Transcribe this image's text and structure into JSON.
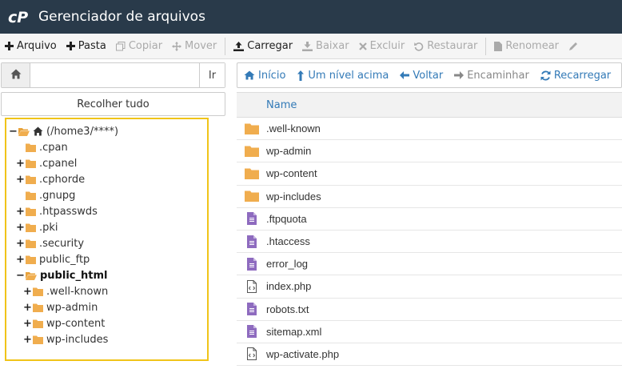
{
  "header": {
    "title": "Gerenciador de arquivos",
    "logo": "cP"
  },
  "toolbar": {
    "buttons": [
      {
        "label": "Arquivo",
        "icon": "plus-icon",
        "enabled": true
      },
      {
        "label": "Pasta",
        "icon": "plus-icon",
        "enabled": true
      },
      {
        "label": "Copiar",
        "icon": "copy-icon",
        "enabled": false
      },
      {
        "label": "Mover",
        "icon": "move-icon",
        "enabled": false
      },
      {
        "label": "Carregar",
        "icon": "upload-icon",
        "enabled": true
      },
      {
        "label": "Baixar",
        "icon": "download-icon",
        "enabled": false
      },
      {
        "label": "Excluir",
        "icon": "delete-icon",
        "enabled": false
      },
      {
        "label": "Restaurar",
        "icon": "restore-icon",
        "enabled": false
      },
      {
        "label": "Renomear",
        "icon": "rename-icon",
        "enabled": false
      }
    ]
  },
  "path": {
    "value": "",
    "go_label": "Ir"
  },
  "collapse_label": "Recolher tudo",
  "tree": [
    {
      "label": "(/home3/****)",
      "toggle": "−",
      "level": 0,
      "open": true,
      "home": true
    },
    {
      "label": ".cpan",
      "toggle": "",
      "level": 1
    },
    {
      "label": ".cpanel",
      "toggle": "+",
      "level": 1
    },
    {
      "label": ".cphorde",
      "toggle": "+",
      "level": 1
    },
    {
      "label": ".gnupg",
      "toggle": "",
      "level": 1
    },
    {
      "label": ".htpasswds",
      "toggle": "+",
      "level": 1
    },
    {
      "label": ".pki",
      "toggle": "+",
      "level": 1
    },
    {
      "label": ".security",
      "toggle": "+",
      "level": 1
    },
    {
      "label": "public_ftp",
      "toggle": "+",
      "level": 1
    },
    {
      "label": "public_html",
      "toggle": "−",
      "level": 1,
      "open": true,
      "bold": true
    },
    {
      "label": ".well-known",
      "toggle": "+",
      "level": 2
    },
    {
      "label": "wp-admin",
      "toggle": "+",
      "level": 2
    },
    {
      "label": "wp-content",
      "toggle": "+",
      "level": 2
    },
    {
      "label": "wp-includes",
      "toggle": "+",
      "level": 2
    }
  ],
  "nav": {
    "buttons": [
      {
        "label": "Início",
        "icon": "home-icon",
        "enabled": true
      },
      {
        "label": "Um nível acima",
        "icon": "level-up-icon",
        "enabled": true
      },
      {
        "label": "Voltar",
        "icon": "arrow-left-icon",
        "enabled": true
      },
      {
        "label": "Encaminhar",
        "icon": "arrow-right-icon",
        "enabled": false
      },
      {
        "label": "Recarregar",
        "icon": "refresh-icon",
        "enabled": true
      }
    ]
  },
  "table": {
    "column_name": "Name",
    "rows": [
      {
        "name": ".well-known",
        "type": "folder"
      },
      {
        "name": "wp-admin",
        "type": "folder"
      },
      {
        "name": "wp-content",
        "type": "folder"
      },
      {
        "name": "wp-includes",
        "type": "folder"
      },
      {
        "name": ".ftpquota",
        "type": "text"
      },
      {
        "name": ".htaccess",
        "type": "text"
      },
      {
        "name": "error_log",
        "type": "text"
      },
      {
        "name": "index.php",
        "type": "code"
      },
      {
        "name": "robots.txt",
        "type": "text"
      },
      {
        "name": "sitemap.xml",
        "type": "text"
      },
      {
        "name": "wp-activate.php",
        "type": "code"
      }
    ]
  },
  "colors": {
    "header_bg": "#293a4a",
    "folder": "#f0ad4e",
    "file_text": "#8e6bbf",
    "link": "#337ab7",
    "tree_highlight": "#f0c419"
  }
}
